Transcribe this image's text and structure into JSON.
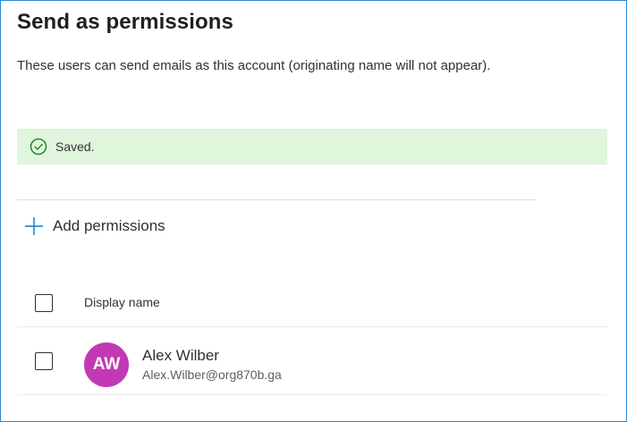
{
  "panel": {
    "title": "Send as permissions",
    "description": "These users can send emails as this account (originating name will not appear)."
  },
  "status_banner": {
    "message": "Saved.",
    "icon": "checkmark-circle-icon",
    "color": "#dff6dd",
    "icon_color": "#107c10"
  },
  "toolbar": {
    "add_label": "Add permissions",
    "add_icon": "plus-icon",
    "accent": "#0078d4"
  },
  "table": {
    "columns": [
      "Display name"
    ],
    "rows": [
      {
        "initials": "AW",
        "name": "Alex Wilber",
        "email": "Alex.Wilber@org870b.ga",
        "avatar_color": "#c239b3",
        "selected": false
      }
    ],
    "select_all": false
  }
}
